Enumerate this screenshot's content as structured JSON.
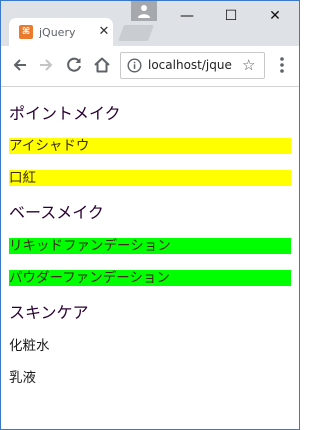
{
  "browser": {
    "tab": {
      "favicon_glyph": "⌘",
      "title": "jQuery",
      "close_glyph": "✕"
    },
    "window_controls": {
      "minimize_glyph": "—",
      "maximize_glyph": "☐",
      "close_glyph": "✕"
    },
    "address_bar": {
      "url": "localhost/jque",
      "star_glyph": "☆"
    },
    "icons": [
      "back-arrow-icon",
      "forward-arrow-icon",
      "reload-icon",
      "home-icon",
      "info-icon",
      "star-icon",
      "kebab-menu-icon",
      "profile-icon"
    ]
  },
  "page": {
    "sections": [
      {
        "heading": "ポイントメイク",
        "items": [
          "アイシャドウ",
          "口紅"
        ]
      },
      {
        "heading": "ベースメイク",
        "items": [
          "リキッドファンデーション",
          "パウダーファンデーション"
        ]
      },
      {
        "heading": "スキンケア",
        "items": [
          "化粧水",
          "乳液"
        ]
      }
    ],
    "highlight_colors": {
      "section_1": "#ffff00",
      "section_2": "#00ff00"
    }
  }
}
